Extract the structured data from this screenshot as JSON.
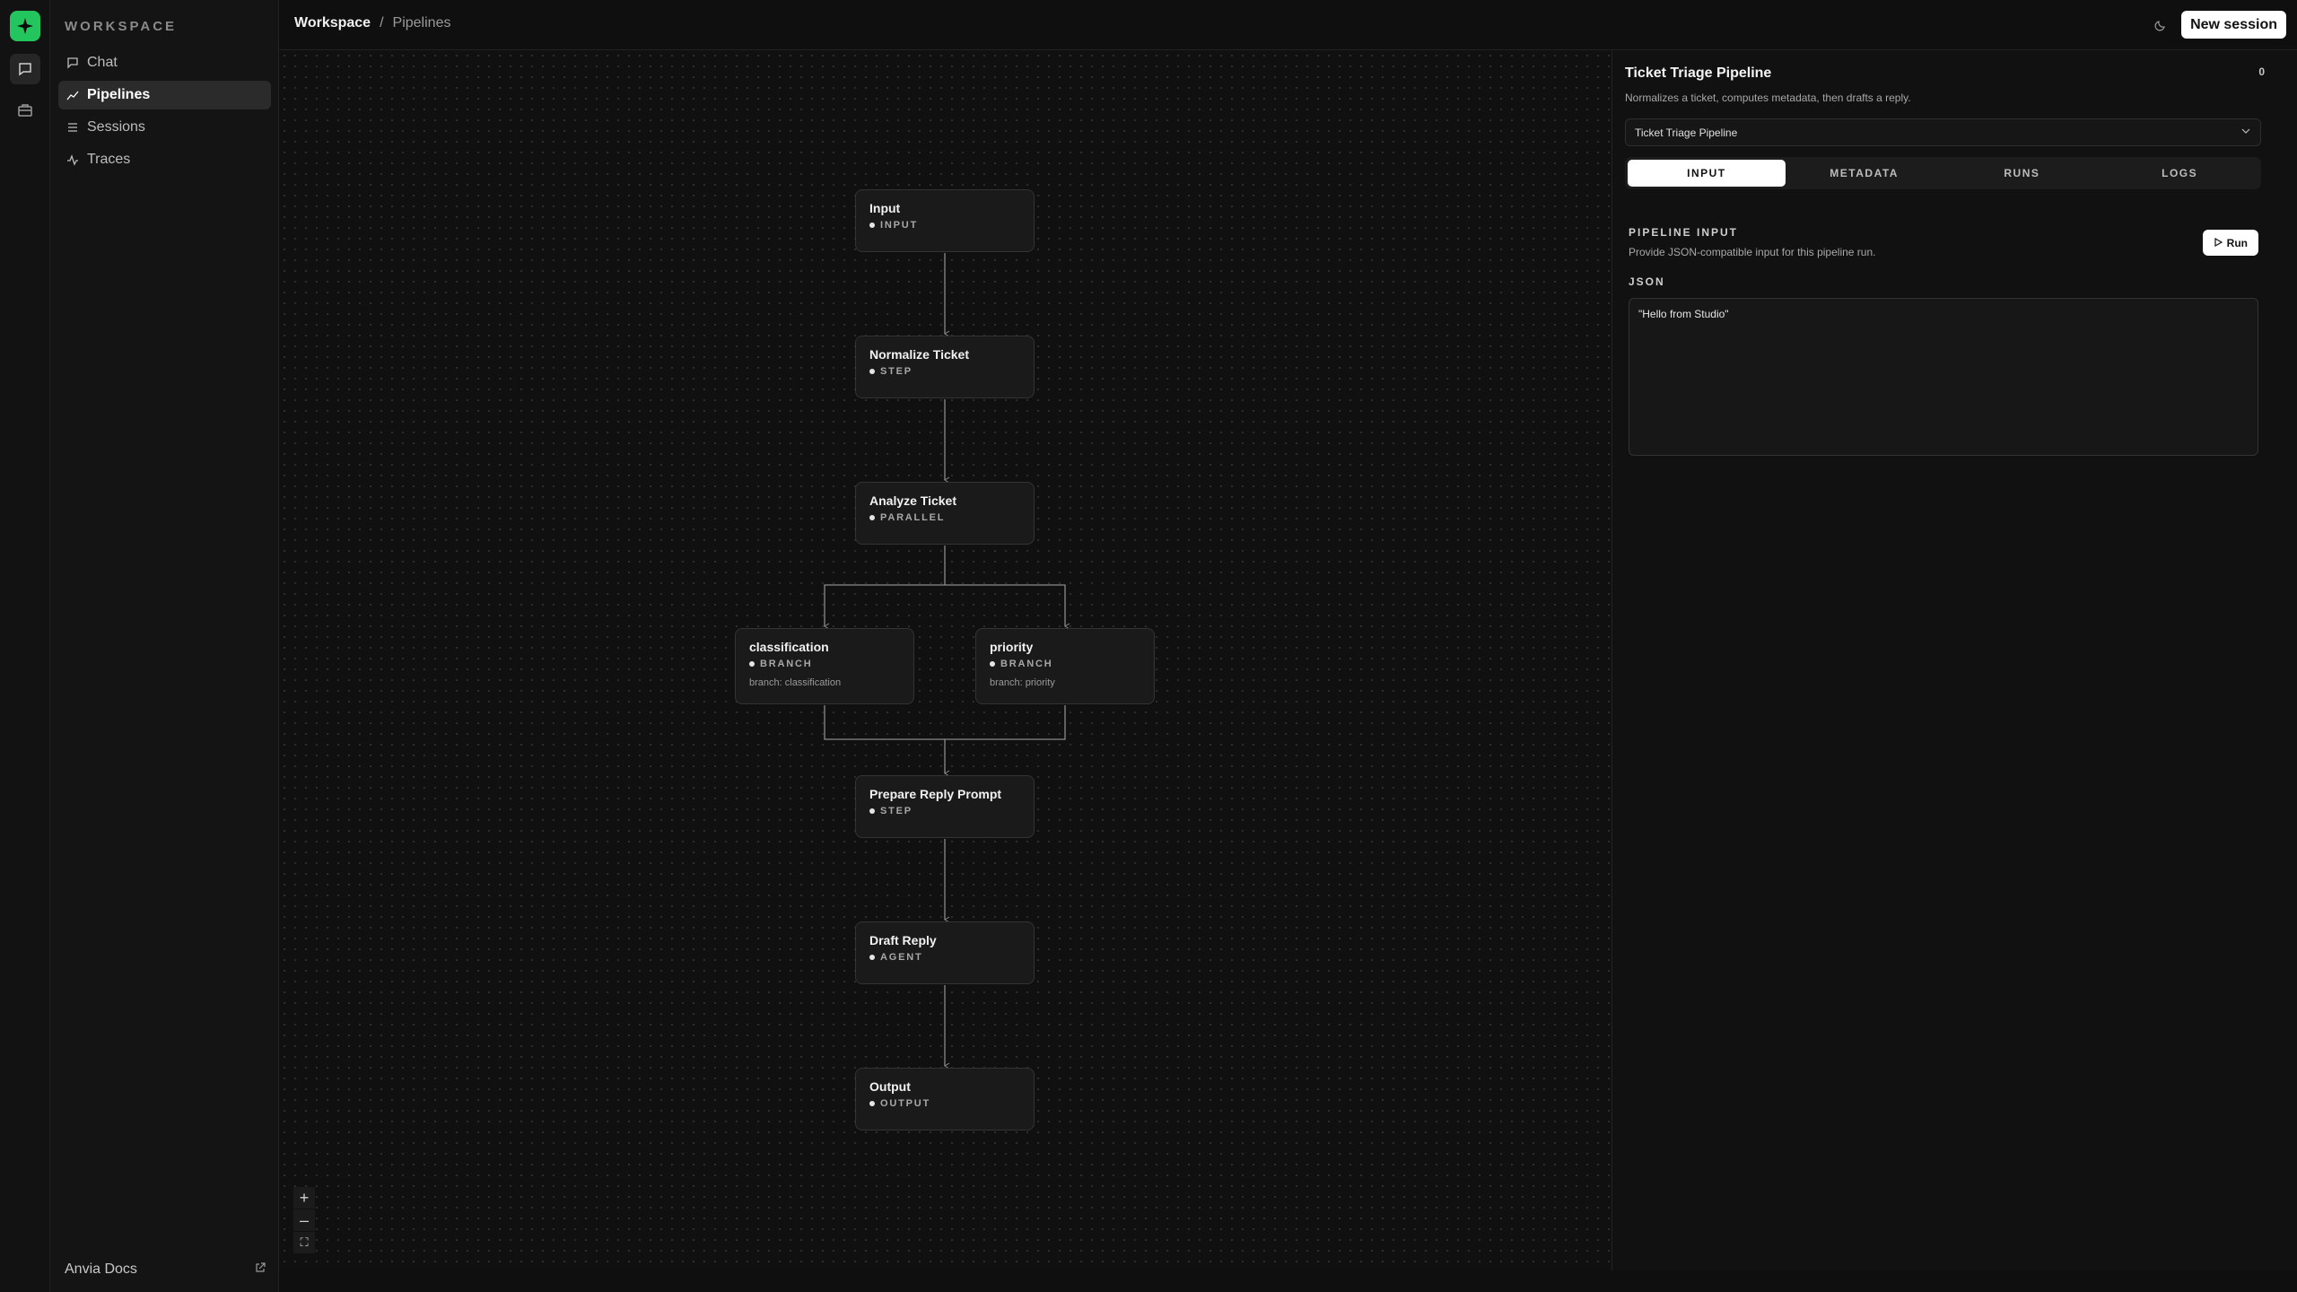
{
  "sidebar": {
    "workspace_label": "WORKSPACE",
    "items": [
      {
        "label": "Chat",
        "icon": "message-square-icon"
      },
      {
        "label": "Pipelines",
        "icon": "trend-line-icon",
        "active": true
      },
      {
        "label": "Sessions",
        "icon": "list-icon"
      },
      {
        "label": "Traces",
        "icon": "activity-icon"
      }
    ],
    "footer_link": "Anvia Docs"
  },
  "breadcrumb": {
    "root": "Workspace",
    "separator": "/",
    "current": "Pipelines"
  },
  "topbar": {
    "new_session_label": "New session",
    "theme_icon": "moon-icon"
  },
  "pipeline": {
    "nodes": [
      {
        "title": "Input",
        "type": "INPUT"
      },
      {
        "title": "Normalize Ticket",
        "type": "STEP"
      },
      {
        "title": "Analyze Ticket",
        "type": "PARALLEL"
      },
      {
        "title": "classification",
        "type": "BRANCH",
        "sub": "branch: classification"
      },
      {
        "title": "priority",
        "type": "BRANCH",
        "sub": "branch: priority"
      },
      {
        "title": "Prepare Reply Prompt",
        "type": "STEP"
      },
      {
        "title": "Draft Reply",
        "type": "AGENT"
      },
      {
        "title": "Output",
        "type": "OUTPUT"
      }
    ]
  },
  "zoom_controls": {
    "zoom_in": "+",
    "zoom_out": "–",
    "fit": "⛶"
  },
  "panel": {
    "title": "Ticket Triage Pipeline",
    "count": "0",
    "description": "Normalizes a ticket, computes metadata, then drafts a reply.",
    "selected_pipeline": "Ticket Triage Pipeline",
    "tabs": [
      {
        "label": "INPUT",
        "active": true
      },
      {
        "label": "METADATA"
      },
      {
        "label": "RUNS"
      },
      {
        "label": "LOGS"
      }
    ],
    "section_title": "PIPELINE INPUT",
    "section_description": "Provide JSON-compatible input for this pipeline run.",
    "run_label": "Run",
    "json_label": "JSON",
    "json_value": "\"Hello from Studio\""
  },
  "colors": {
    "accent": "#22c55e",
    "background": "#0f0f0f",
    "node_bg": "#1a1a1a"
  }
}
